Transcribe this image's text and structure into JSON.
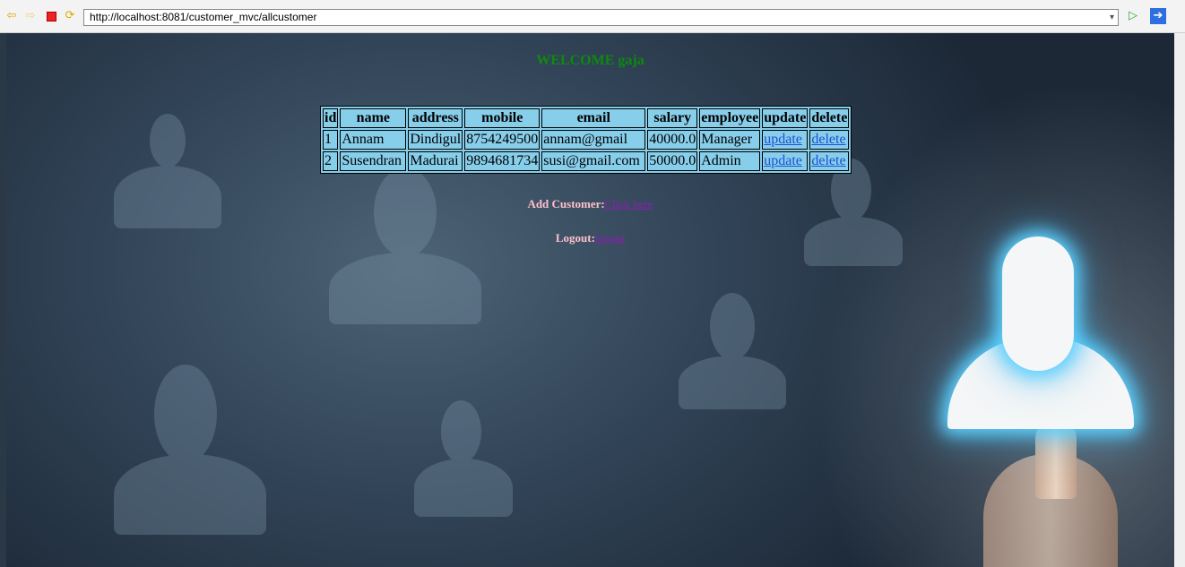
{
  "browser": {
    "url": "http://localhost:8081/customer_mvc/allcustomer",
    "icons": [
      "back-icon",
      "forward-icon",
      "stop-icon",
      "refresh-icon",
      "dropdown-icon",
      "go-icon",
      "open-external-icon"
    ]
  },
  "page": {
    "welcome": "WELCOME gaja",
    "table": {
      "headers": [
        "id",
        "name",
        "address",
        "mobile",
        "email",
        "salary",
        "employee",
        "update",
        "delete"
      ],
      "rows": [
        {
          "id": "1",
          "name": "Annam",
          "address": "Dindigul",
          "mobile": "8754249500",
          "email": "annam@gmail",
          "salary": "40000.0",
          "employee": "Manager",
          "update": "update",
          "delete": "delete"
        },
        {
          "id": "2",
          "name": "Susendran",
          "address": "Madurai",
          "mobile": "9894681734",
          "email": "susi@gmail.com",
          "salary": "50000.0",
          "employee": "Admin",
          "update": "update",
          "delete": "delete"
        }
      ]
    },
    "add_customer": {
      "label": "Add Customer:",
      "link": "Click here"
    },
    "logout": {
      "label": "Logout:",
      "link": "logout"
    }
  },
  "colors": {
    "welcome": "#0e8a0e",
    "table_bg": "#87ceeb",
    "label_text": "#ffc0cb",
    "link_visited": "#8a1fb0"
  }
}
